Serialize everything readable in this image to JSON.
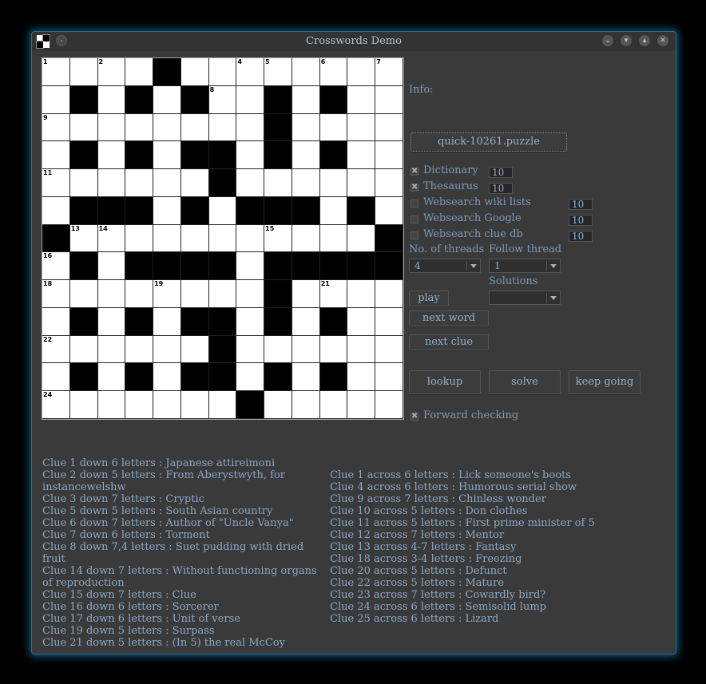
{
  "window": {
    "title": "Crosswords Demo"
  },
  "grid": {
    "size": 13,
    "rows": [
      "....#........",
      ".#.#.#..#.#..",
      "........#....",
      ".#.#.##.#.#..",
      "......#......",
      ".###.#.###.#.",
      "#...........#",
      ".#.####.#####.",
      "........#....",
      ".#.#.##.#.#..",
      "......#......",
      ".#.#.##.#.#..",
      ".......#....."
    ],
    "numbers": [
      {
        "r": 0,
        "c": 0,
        "n": "1"
      },
      {
        "r": 0,
        "c": 2,
        "n": "2"
      },
      {
        "r": 0,
        "c": 4,
        "n": "3"
      },
      {
        "r": 0,
        "c": 7,
        "n": "4"
      },
      {
        "r": 0,
        "c": 8,
        "n": "5"
      },
      {
        "r": 0,
        "c": 10,
        "n": "6"
      },
      {
        "r": 0,
        "c": 12,
        "n": "7"
      },
      {
        "r": 1,
        "c": 6,
        "n": "8"
      },
      {
        "r": 2,
        "c": 0,
        "n": "9"
      },
      {
        "r": 2,
        "c": 8,
        "n": "10"
      },
      {
        "r": 4,
        "c": 0,
        "n": "11"
      },
      {
        "r": 4,
        "c": 6,
        "n": "12"
      },
      {
        "r": 6,
        "c": 1,
        "n": "13"
      },
      {
        "r": 6,
        "c": 2,
        "n": "14"
      },
      {
        "r": 6,
        "c": 8,
        "n": "15"
      },
      {
        "r": 7,
        "c": 0,
        "n": "16"
      },
      {
        "r": 7,
        "c": 12,
        "n": "17"
      },
      {
        "r": 8,
        "c": 0,
        "n": "18"
      },
      {
        "r": 8,
        "c": 4,
        "n": "19"
      },
      {
        "r": 8,
        "c": 8,
        "n": "20"
      },
      {
        "r": 8,
        "c": 10,
        "n": "21"
      },
      {
        "r": 10,
        "c": 0,
        "n": "22"
      },
      {
        "r": 10,
        "c": 6,
        "n": "23"
      },
      {
        "r": 12,
        "c": 0,
        "n": "24"
      },
      {
        "r": 12,
        "c": 7,
        "n": "25"
      }
    ]
  },
  "panel": {
    "info_label": "Info:",
    "puzzle_button": "quick-10261.puzzle",
    "options": [
      {
        "label": "Dictionary",
        "checked": true,
        "value": "10"
      },
      {
        "label": "Thesaurus",
        "checked": true,
        "value": "10"
      },
      {
        "label": "Websearch wiki lists",
        "checked": false,
        "value": "10"
      },
      {
        "label": "Websearch Google",
        "checked": false,
        "value": "10"
      },
      {
        "label": "Websearch clue db",
        "checked": false,
        "value": "10"
      }
    ],
    "threads_label": "No. of threads",
    "threads_value": "4",
    "follow_label": "Follow thread",
    "follow_value": "1",
    "solutions_label": "Solutions",
    "solutions_value": "",
    "play": "play",
    "next_word": "next word",
    "next_clue": "next clue",
    "lookup": "lookup",
    "solve": "solve",
    "keep_going": "keep going",
    "forward_checking": "Forward checking",
    "forward_checked": true
  },
  "clues_down": [
    "Clue 1 down 6 letters : Japanese attireimoni",
    "Clue 2 down 5 letters : From Aberystwyth, for instancewelshw",
    "Clue 3 down 7 letters : Cryptic",
    "Clue 5 down 5 letters : South Asian country",
    "Clue 6 down 7 letters : Author of \"Uncle Vanya\"",
    "Clue 7 down 6 letters : Torment",
    "Clue 8 down 7,4 letters : Suet pudding with dried fruit",
    "Clue 14 down 7 letters : Without functioning organs of reproduction",
    "Clue 15 down 7 letters : Clue",
    "Clue 16 down 6 letters : Sorcerer",
    "Clue 17 down 6 letters : Unit of verse",
    "Clue 19 down 5 letters : Surpass",
    "Clue 21 down 5 letters : (In 5) the real McCoy"
  ],
  "clues_across": [
    "Clue 1 across 6 letters : Lick someone's boots",
    "Clue 4 across 6 letters : Humorous serial show",
    "Clue 9 across 7 letters : Chinless wonder",
    "Clue 10 across 5 letters : Don clothes",
    "Clue 11 across 5 letters : First prime minister of 5",
    "Clue 12 across 7 letters : Mentor",
    "Clue 13 across 4-7 letters : Fantasy",
    "Clue 18 across 3-4 letters : Freezing",
    "Clue 20 across 5 letters : Defunct",
    "Clue 22 across 5 letters : Mature",
    "Clue 23 across 7 letters : Cowardly bird?",
    "Clue 24 across 6 letters : Semisolid lump",
    "Clue 25 across 6 letters : Lizard"
  ]
}
